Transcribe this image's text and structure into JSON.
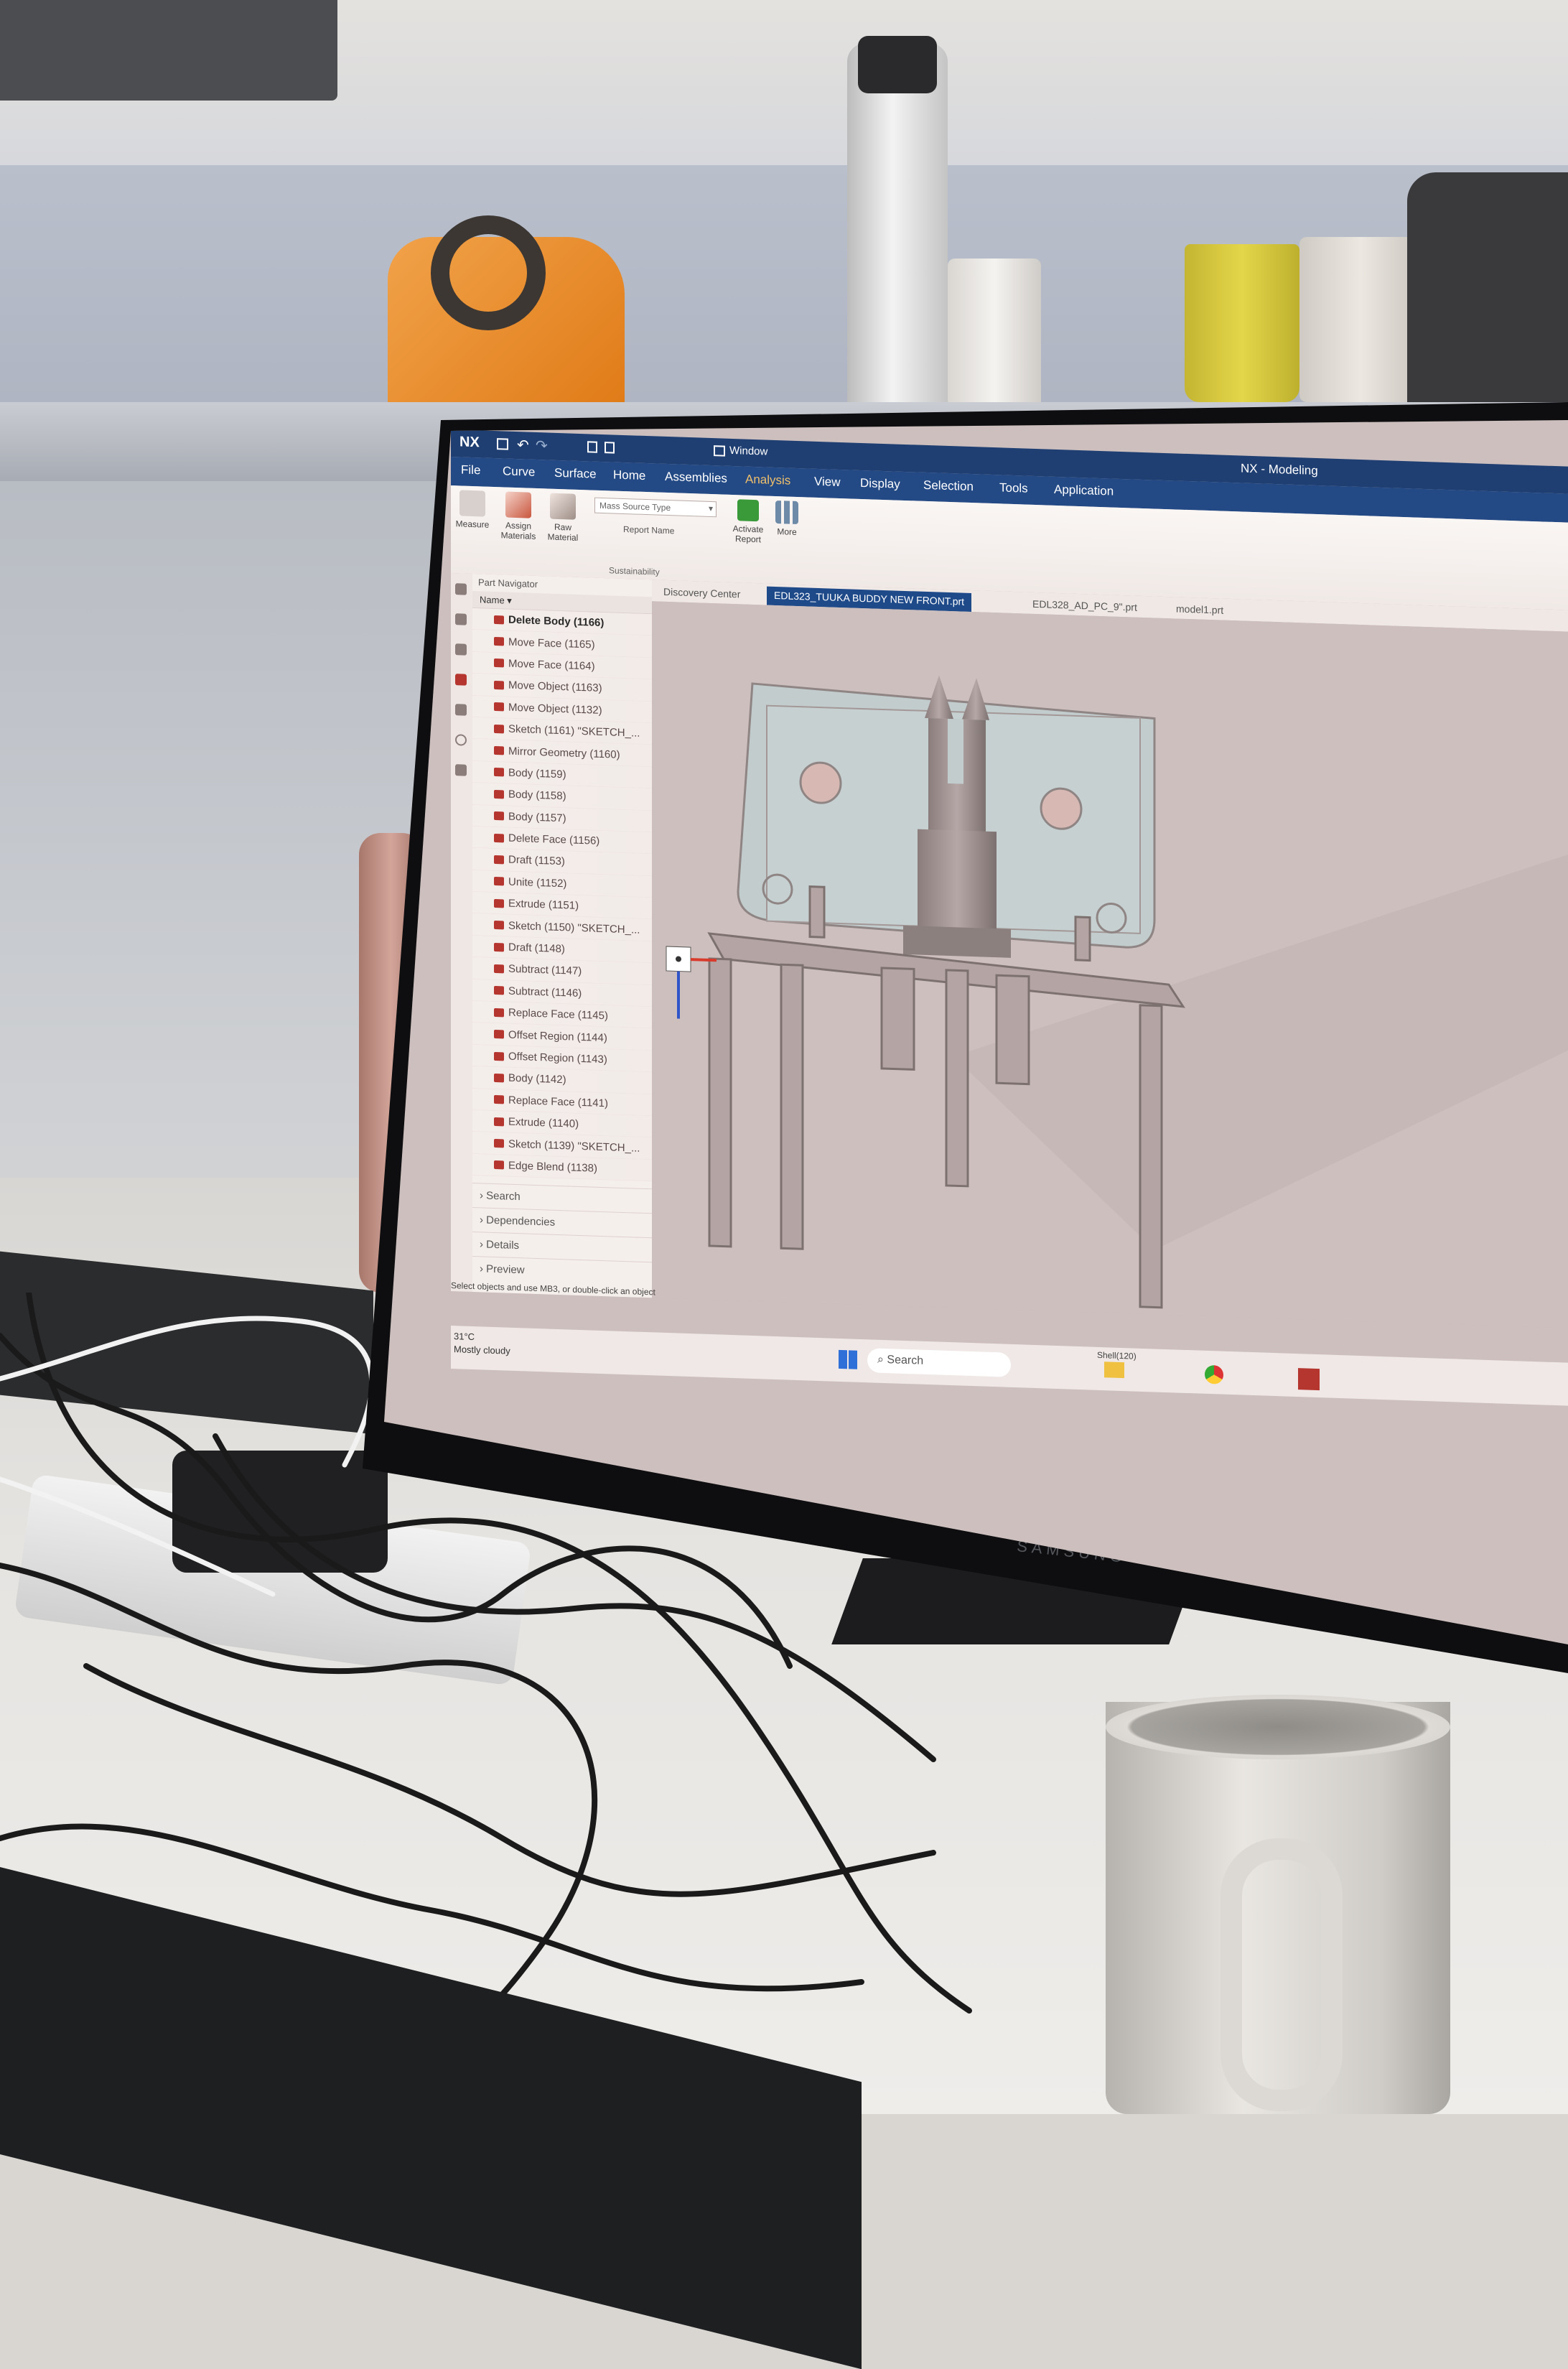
{
  "app": {
    "logo": "NX",
    "title": "NX - Modeling",
    "quick_access_window_label": "Window",
    "menu": [
      "File",
      "Curve",
      "Surface",
      "Home",
      "Assemblies",
      "Analysis",
      "View",
      "Display",
      "Selection",
      "Tools",
      "Application"
    ],
    "active_menu": "Analysis"
  },
  "ribbon": {
    "measure_label": "Measure",
    "assign_materials_label": "Assign Materials",
    "raw_material_label": "Raw Material",
    "mass_source_type_placeholder": "Mass Source Type",
    "report_name_label": "Report Name",
    "activate_report_label": "Activate Report",
    "more_label": "More",
    "group_label": "Sustainability"
  },
  "part_navigator": {
    "title": "Part Navigator",
    "column_name": "Name",
    "items": [
      "Delete Body (1166)",
      "Move Face (1165)",
      "Move Face (1164)",
      "Move Object (1163)",
      "Move Object (1132)",
      "Sketch (1161) \"SKETCH_...",
      "Mirror Geometry (1160)",
      "Body (1159)",
      "Body (1158)",
      "Body (1157)",
      "Delete Face (1156)",
      "Draft (1153)",
      "Unite (1152)",
      "Extrude (1151)",
      "Sketch (1150) \"SKETCH_...",
      "Draft (1148)",
      "Subtract (1147)",
      "Subtract (1146)",
      "Replace Face (1145)",
      "Offset Region (1144)",
      "Offset Region (1143)",
      "Body (1142)",
      "Replace Face (1141)",
      "Extrude (1140)",
      "Sketch (1139) \"SKETCH_...",
      "Edge Blend (1138)"
    ],
    "panes": [
      "Search",
      "Dependencies",
      "Details",
      "Preview"
    ]
  },
  "tabs": [
    "Discovery Center",
    "EDL323_TUUKA BUDDY NEW FRONT.prt",
    "EDL328_AD_PC_9\".prt",
    "model1.prt"
  ],
  "active_tab": 1,
  "status_prompt": "Select objects and use MB3, or double-click an object",
  "weather": {
    "temperature": "31°C",
    "condition": "Mostly cloudy"
  },
  "taskbar": {
    "search_placeholder": "Search",
    "shell_label": "Shell(120)"
  },
  "monitor_brand": "SAMSUNG",
  "colors": {
    "title_bar": "#1f3f73",
    "menu_bar": "#244a86",
    "active_tab": "#1f4a8a",
    "feature_icon": "#b5352f",
    "model_fill": "#c3b2b1",
    "model_glass": "#c2cccd"
  }
}
